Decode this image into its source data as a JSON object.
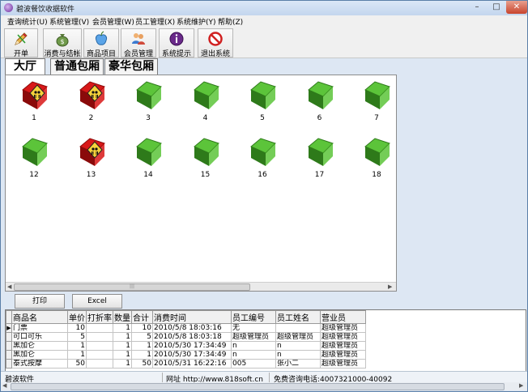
{
  "window": {
    "title": "碧波餐饮收据软件",
    "controls": {
      "minimize": "–",
      "maximize": "□",
      "close": "✕"
    }
  },
  "menu": [
    "查询统计(U)",
    "系统管理(V)",
    "会员管理(W)",
    "员工管理(X)",
    "系统维护(Y)",
    "帮助(Z)"
  ],
  "toolbar": [
    {
      "label": "开单",
      "icon": "pencil-icon"
    },
    {
      "label": "消费与结帐",
      "icon": "money-bag-icon"
    },
    {
      "label": "商品项目",
      "icon": "apple-icon"
    },
    {
      "label": "会员管理",
      "icon": "users-icon"
    },
    {
      "label": "系统提示",
      "icon": "info-icon"
    },
    {
      "label": "退出系统",
      "icon": "no-entry-icon"
    }
  ],
  "tabs": [
    "大厅",
    "普通包厢",
    "豪华包厢"
  ],
  "rooms": [
    {
      "label": "1",
      "occupied": true
    },
    {
      "label": "2",
      "occupied": true
    },
    {
      "label": "3",
      "occupied": false
    },
    {
      "label": "4",
      "occupied": false
    },
    {
      "label": "5",
      "occupied": false
    },
    {
      "label": "6",
      "occupied": false
    },
    {
      "label": "7",
      "occupied": false
    },
    {
      "label": "12",
      "occupied": false
    },
    {
      "label": "13",
      "occupied": true
    },
    {
      "label": "14",
      "occupied": false
    },
    {
      "label": "15",
      "occupied": false
    },
    {
      "label": "16",
      "occupied": false
    },
    {
      "label": "17",
      "occupied": false
    },
    {
      "label": "18",
      "occupied": false
    }
  ],
  "colors": {
    "free_room": "#5cc43a",
    "occupied_room": "#d81818",
    "accent": "#2f6fd0"
  },
  "actions": {
    "print": "打印",
    "excel": "Excel"
  },
  "table": {
    "columns": [
      "商品名",
      "单价",
      "打折率",
      "数量",
      "合计",
      "消费时间",
      "员工编号",
      "员工姓名",
      "营业员"
    ],
    "rows": [
      [
        "门票",
        "10",
        "",
        "1",
        "10",
        "2010/5/8 18:03:16",
        "无",
        "",
        "超级管理员"
      ],
      [
        "可口可乐",
        "5",
        "",
        "1",
        "5",
        "2010/5/8 18:03:18",
        "超级管理员",
        "超级管理员",
        "超级管理员"
      ],
      [
        "黑加仑",
        "1",
        "",
        "1",
        "1",
        "2010/5/30 17:34:49",
        "n",
        "n",
        "超级管理员"
      ],
      [
        "黑加仑",
        "1",
        "",
        "1",
        "1",
        "2010/5/30 17:34:49",
        "n",
        "n",
        "超级管理员"
      ],
      [
        "泰式按摩",
        "50",
        "",
        "1",
        "50",
        "2010/5/31 16:22:16",
        "005",
        "张小二",
        "超级管理员"
      ]
    ],
    "current_row_marker": "▶"
  },
  "status": {
    "app": "碧波软件",
    "website": "网址 http://www.818soft.cn",
    "hotline": "免费咨询电话:4007321000-40092"
  }
}
